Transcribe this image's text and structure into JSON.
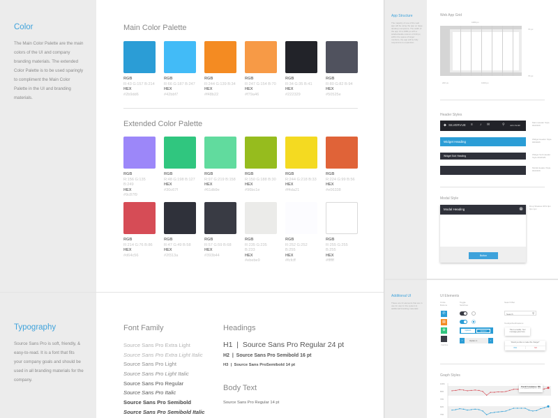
{
  "color_section": {
    "title": "Color",
    "description": "The Main Color Palette are the main colors of the UI and company branding materials. The extended Color Palette is to be used sparingly to compliment the Main Color Palette in the UI and branding materials."
  },
  "main_palette": {
    "title": "Main Color Palette",
    "rgb_label": "RGB",
    "hex_label": "HEX",
    "swatches": [
      {
        "color": "#2b9dd6",
        "rgb": "R:43 G:157 B:214",
        "hex": "#2b9dd6"
      },
      {
        "color": "#42bbf7",
        "rgb": "R:66 G:187 B:247",
        "hex": "#42bbf7"
      },
      {
        "color": "#f48b22",
        "rgb": "R:244 G:139 B:34",
        "hex": "#f48b22"
      },
      {
        "color": "#f79a46",
        "rgb": "R:247 G:154 B:70",
        "hex": "#f79a46"
      },
      {
        "color": "#222329",
        "rgb": "R:34 G:35 B:41",
        "hex": "#222329"
      },
      {
        "color": "#50525e",
        "rgb": "R:80 G:82 B:94",
        "hex": "#50525e"
      }
    ]
  },
  "extended_palette": {
    "title": "Extended Color Palette",
    "rgb_label": "RGB",
    "hex_label": "HEX",
    "swatches": [
      {
        "color": "#9c87f9",
        "rgb": "R:156 G:135 B:249",
        "hex": "#9c87f9"
      },
      {
        "color": "#30c67f",
        "rgb": "R:48 G:198 B:127",
        "hex": "#30c67f"
      },
      {
        "color": "#61db9e",
        "rgb": "R:97 G:219 B:158",
        "hex": "#61db9e"
      },
      {
        "color": "#96bc1e",
        "rgb": "R:150 G:188 B:30",
        "hex": "#96bc1e"
      },
      {
        "color": "#f4da21",
        "rgb": "R:244 G:218 B:33",
        "hex": "#f4da21"
      },
      {
        "color": "#e06338",
        "rgb": "R:224 G:99 B:56",
        "hex": "#e06338"
      },
      {
        "color": "#d64c56",
        "rgb": "R:214 G:76 B:86",
        "hex": "#d64c56"
      },
      {
        "color": "#2f313a",
        "rgb": "R:47 G:49 B:58",
        "hex": "#2f313a"
      },
      {
        "color": "#393b44",
        "rgb": "R:57 G:59 B:68",
        "hex": "#393b44"
      },
      {
        "color": "#ebebe9",
        "rgb": "R:235 G:235 B:233",
        "hex": "#ebebe9"
      },
      {
        "color": "#fcfcff",
        "rgb": "R:252 G:252 B:255",
        "hex": "#fcfcff"
      },
      {
        "color": "#ffffff",
        "rgb": "R:255 G:255 B:255",
        "hex": "#ffffff"
      }
    ]
  },
  "typography_section": {
    "title": "Typography",
    "description": "Source Sans Pro is soft, friendly, & easy-to-read. It is a font that fits your company goals and should be used in all branding materials for the company."
  },
  "font_family": {
    "title": "Font Family",
    "items": [
      "Source Sans Pro Extra Light",
      "Source Sans Pro Extra Light Italic",
      "Source Sans Pro Light",
      "Source Sans Pro Light Italic",
      "Source Sans Pro Regular",
      "Source Sans Pro Italic",
      "Source Sans Pro Semibold",
      "Source Sans Pro Semibold Italic"
    ]
  },
  "headings": {
    "title": "Headings",
    "h1": "H1  |  Source Sans Pro Regular 24 pt",
    "h2": "H2  |  Source Sans Pro Semibold 16 pt",
    "h3": "H3  |  Source Sans ProSemibold 14 pt"
  },
  "body_text": {
    "title": "Body Text",
    "sample": "Source Sans Pro Regular 14 pt"
  },
  "app_structure": {
    "title": "App Structure",
    "description": "The majority of use of the web app will be using the app on large desktop computers. The width of the app UI is 1680 px with a sidebar/aside column of 240 px, within the space of larger monitors, the app will be fully responsive to expansion.",
    "grid_title": "Web App Grid",
    "width_label": "1680 px",
    "top_label": "70 px",
    "bottom_label": "70 px",
    "sidebar_label": "240 px",
    "content_label": "1300 px"
  },
  "header_styles": {
    "title": "Header Styles",
    "brand": "SILVERVUE",
    "user": "John Smith",
    "widget_heading": "Widget Heading",
    "widget_sub_heading": "Widget Sub Heading",
    "notes": [
      "Main Header Style #222329",
      "Widget Header Style #2b9dd6",
      "Widget Sub Header Style #222329",
      "Modal Header Style #222329"
    ]
  },
  "modal_style": {
    "title": "Modal Style",
    "heading": "Modal Heading",
    "button": "Button",
    "note": "Drop Shadow 20% 0px 0px 1px"
  },
  "additional_ui": {
    "title": "Additional UI",
    "description": "These are UI elements that are in use for user in the system & additional branding materials."
  },
  "ui_elements": {
    "title": "UI Elements",
    "icon_col": "Circle Buttons",
    "toggle_col": "Toggle Switches",
    "search_col": "Search Bar",
    "search_placeholder": "Search",
    "tooltip_label": "Tooltips/Notifications",
    "tooltip_text": "This is a tooltip. Your message goes here.",
    "confirm_text": "Would you like to make this change?",
    "yes": "YES",
    "no": "NO",
    "option1": "Option1",
    "option2": "Option2",
    "stepper_value": "Option 1",
    "icon_caption": "Inactive"
  },
  "graph_styles": {
    "title": "Graph Styles",
    "tooltip_title": "Overall Compliance: 78%",
    "tooltip_sub": "Last updated on Feb 12, 2015"
  },
  "chart_data": {
    "type": "line",
    "title": "Graph Styles",
    "y_ticks": [
      "100%",
      "85%",
      "70%",
      "60%",
      "75%"
    ],
    "series": [
      {
        "name": "red",
        "color": "#d64c56",
        "values": [
          72,
          73,
          75,
          74,
          72,
          73,
          74,
          73,
          70,
          60,
          68,
          68,
          69,
          69,
          70,
          73,
          76,
          76,
          76,
          76,
          72,
          71,
          72,
          75,
          77,
          80
        ]
      },
      {
        "name": "blue",
        "color": "#2b9dd6",
        "values": [
          62,
          63,
          65,
          64,
          62,
          63,
          64,
          63,
          60,
          52,
          56,
          57,
          58,
          59,
          60,
          63,
          66,
          66,
          66,
          66,
          62,
          60,
          61,
          65,
          67,
          70
        ]
      }
    ]
  }
}
